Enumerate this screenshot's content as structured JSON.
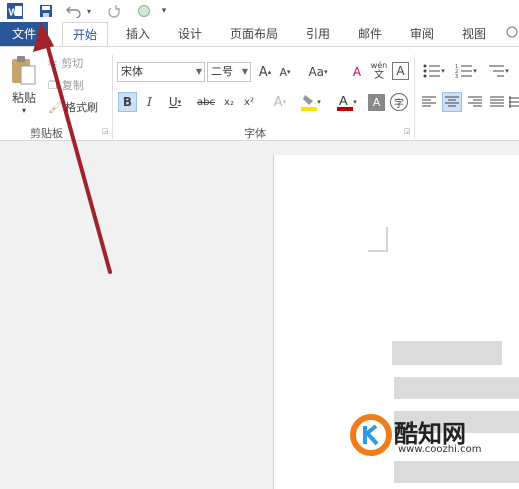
{
  "quick_access": {
    "word_icon": "W",
    "undo_arrow": "▾",
    "customize": "▾"
  },
  "tabs": [
    "文件",
    "开始",
    "插入",
    "设计",
    "页面布局",
    "引用",
    "邮件",
    "审阅",
    "视图"
  ],
  "clipboard": {
    "paste": "粘贴",
    "cut": "剪切",
    "copy": "复制",
    "format_painter": "格式刷",
    "group": "剪贴板"
  },
  "font": {
    "name": "宋体",
    "size": "二号",
    "grow": "A",
    "shrink": "A",
    "change_case": "Aa",
    "clear": "A",
    "phonetic_top": "wén",
    "phonetic_bottom": "文",
    "border": "A",
    "bold": "B",
    "italic": "I",
    "underline": "U",
    "strike": "abc",
    "subscript": "x₂",
    "superscript": "x²",
    "group": "字体"
  },
  "watermark": {
    "name": "酷知网",
    "url": "www.coozhi.com"
  },
  "colors": {
    "accent": "#2b579a",
    "arrow": "#a0232a",
    "wm_orange": "#f07d1a",
    "wm_blue": "#2a9de0"
  }
}
